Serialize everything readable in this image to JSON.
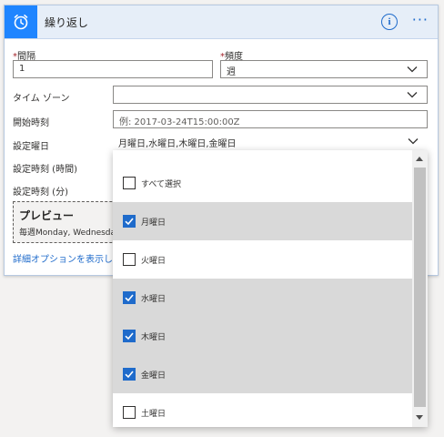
{
  "header": {
    "title": "繰り返し",
    "icon": "alarm-clock-icon",
    "accent": "#1f85ff"
  },
  "fields": {
    "interval": {
      "label": "間隔",
      "value": "1"
    },
    "frequency": {
      "label": "頻度",
      "value": "週"
    },
    "timezone": {
      "label": "タイム ゾーン",
      "value": ""
    },
    "start_time": {
      "label": "開始時刻",
      "placeholder": "例: 2017-03-24T15:00:00Z"
    },
    "weekdays": {
      "label": "設定曜日",
      "value": "月曜日,水曜日,木曜日,金曜日"
    },
    "hours": {
      "label": "設定時刻 (時間)"
    },
    "minutes": {
      "label": "設定時刻 (分)"
    }
  },
  "preview": {
    "title": "プレビュー",
    "text": "毎週Monday, Wednesday"
  },
  "advanced_link": "詳細オプションを表示し",
  "dropdown": {
    "options": [
      {
        "label": "すべて選択",
        "checked": false
      },
      {
        "label": "月曜日",
        "checked": true
      },
      {
        "label": "火曜日",
        "checked": false
      },
      {
        "label": "水曜日",
        "checked": true
      },
      {
        "label": "木曜日",
        "checked": true
      },
      {
        "label": "金曜日",
        "checked": true
      },
      {
        "label": "土曜日",
        "checked": false
      }
    ]
  },
  "colors": {
    "checkbox_checked": "#1f6bcb",
    "selected_row": "#d9d9d9",
    "link": "#1f6bcb",
    "required": "#a4262c"
  }
}
